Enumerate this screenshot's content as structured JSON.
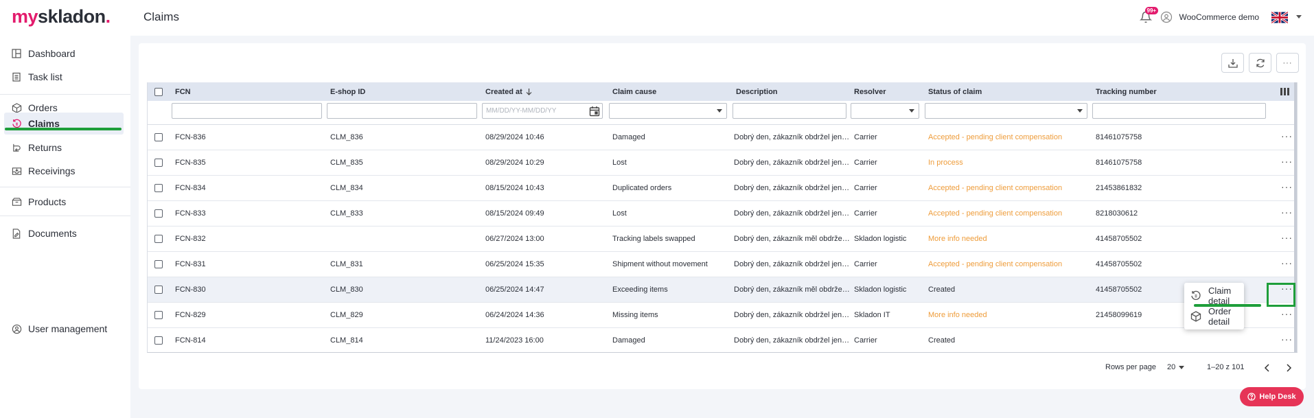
{
  "header": {
    "logo_prefix": "my",
    "logo_suffix": "skladon",
    "logo_dot": ".",
    "title": "Claims",
    "notification_count": "99+",
    "user_name": "WooCommerce demo"
  },
  "sidebar": {
    "items": [
      {
        "label": "Dashboard",
        "icon": "dashboard-icon"
      },
      {
        "label": "Task list",
        "icon": "task-list-icon"
      },
      {
        "label": "Orders",
        "icon": "box-icon"
      },
      {
        "label": "Claims",
        "icon": "claims-icon"
      },
      {
        "label": "Returns",
        "icon": "returns-icon"
      },
      {
        "label": "Receivings",
        "icon": "receivings-icon"
      },
      {
        "label": "Products",
        "icon": "products-icon"
      },
      {
        "label": "Documents",
        "icon": "documents-icon"
      }
    ],
    "bottom_item": {
      "label": "User management",
      "icon": "user-management-icon"
    },
    "active": "Claims"
  },
  "table": {
    "columns": [
      "FCN",
      "E-shop ID",
      "Created at",
      "Claim cause",
      "Description",
      "Resolver",
      "Status of claim",
      "Tracking number"
    ],
    "date_placeholder": "MM/DD/YY-MM/DD/YY",
    "rows": [
      {
        "fcn": "FCN-836",
        "eshop": "CLM_836",
        "created": "08/29/2024 10:46",
        "cause": "Damaged",
        "desc": "Dobrý den, zákazník obdržel jen…",
        "resolver": "Carrier",
        "status": "Accepted - pending client compensation",
        "tracking": "81461075758"
      },
      {
        "fcn": "FCN-835",
        "eshop": "CLM_835",
        "created": "08/29/2024 10:29",
        "cause": "Lost",
        "desc": "Dobrý den, zákazník obdržel jen…",
        "resolver": "Carrier",
        "status": "In process",
        "tracking": "81461075758"
      },
      {
        "fcn": "FCN-834",
        "eshop": "CLM_834",
        "created": "08/15/2024 10:43",
        "cause": "Duplicated orders",
        "desc": "Dobrý den, zákazník obdržel jen…",
        "resolver": "Carrier",
        "status": "Accepted - pending client compensation",
        "tracking": "21453861832"
      },
      {
        "fcn": "FCN-833",
        "eshop": "CLM_833",
        "created": "08/15/2024 09:49",
        "cause": "Lost",
        "desc": "Dobrý den, zákazník obdržel jen…",
        "resolver": "Carrier",
        "status": "Accepted - pending client compensation",
        "tracking": "8218030612"
      },
      {
        "fcn": "FCN-832",
        "eshop": "",
        "created": "06/27/2024 13:00",
        "cause": "Tracking labels swapped",
        "desc": "Dobrý den, zákazník měl obdrže…",
        "resolver": "Skladon logistic",
        "status": "More info needed",
        "tracking": "41458705502"
      },
      {
        "fcn": "FCN-831",
        "eshop": "CLM_831",
        "created": "06/25/2024 15:35",
        "cause": "Shipment without movement",
        "desc": "Dobrý den, zákazník obdržel jen…",
        "resolver": "Carrier",
        "status": "Accepted - pending client compensation",
        "tracking": "41458705502"
      },
      {
        "fcn": "FCN-830",
        "eshop": "CLM_830",
        "created": "06/25/2024 14:47",
        "cause": "Exceeding items",
        "desc": "Dobrý den, zákazník měl obdrže…",
        "resolver": "Skladon logistic",
        "status": "Created",
        "tracking": "41458705502"
      },
      {
        "fcn": "FCN-829",
        "eshop": "CLM_829",
        "created": "06/24/2024 14:36",
        "cause": "Missing items",
        "desc": "Dobrý den, zákazník obdržel jen…",
        "resolver": "Skladon IT",
        "status": "More info needed",
        "tracking": "21458099619"
      },
      {
        "fcn": "FCN-814",
        "eshop": "CLM_814",
        "created": "11/24/2023 16:00",
        "cause": "Damaged",
        "desc": "Dobrý den, zákazník obdržel jen…",
        "resolver": "Carrier",
        "status": "Created",
        "tracking": ""
      }
    ]
  },
  "pagination": {
    "rows_per_page_label": "Rows per page",
    "rows_per_page": "20",
    "range": "1–20 z 101"
  },
  "context_menu": {
    "items": [
      "Claim detail",
      "Order detail"
    ]
  },
  "help_desk": "Help Desk",
  "colors": {
    "brand": "#e31b6d",
    "status_orange": "#ee9c3a",
    "highlight_green": "#1e9e3a",
    "help_desk": "#e63457"
  }
}
